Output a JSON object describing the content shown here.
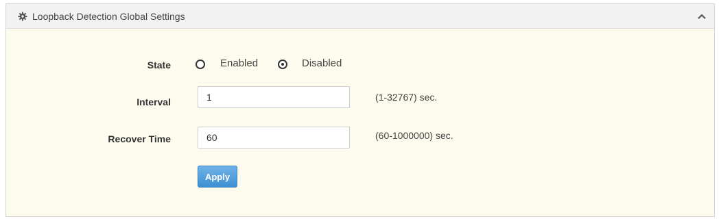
{
  "panel": {
    "title": "Loopback Detection Global Settings",
    "title_icon": "gear-icon",
    "collapse_icon": "chevron-up-icon"
  },
  "form": {
    "state": {
      "label": "State",
      "options": [
        {
          "label": "Enabled",
          "checked": false
        },
        {
          "label": "Disabled",
          "checked": true
        }
      ]
    },
    "interval": {
      "label": "Interval",
      "value": "1",
      "hint": "(1-32767) sec."
    },
    "recover_time": {
      "label": "Recover Time",
      "value": "60",
      "hint": "(60-1000000) sec."
    },
    "apply_label": "Apply"
  },
  "colors": {
    "panel_bg": "#fcfbee",
    "header_bg": "#f2f2f2",
    "button_blue": "#428bca"
  }
}
